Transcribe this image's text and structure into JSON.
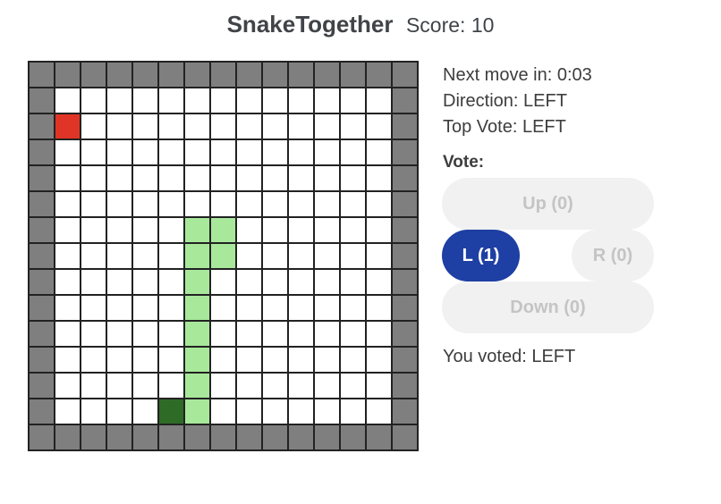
{
  "header": {
    "title": "SnakeTogether",
    "score": "Score: 10"
  },
  "info": {
    "next_move": "Next move in: 0:03",
    "direction": "Direction: LEFT",
    "top_vote": "Top Vote: LEFT"
  },
  "vote": {
    "label": "Vote:",
    "up": "Up (0)",
    "left": "L (1)",
    "right": "R (0)",
    "down": "Down (0)",
    "selected": "left",
    "you_voted": "You voted: LEFT"
  },
  "board": {
    "cols": 15,
    "rows": 15,
    "food": [
      [
        1,
        2
      ]
    ],
    "snake_head": [
      [
        5,
        13
      ]
    ],
    "snake_body": [
      [
        6,
        6
      ],
      [
        7,
        6
      ],
      [
        6,
        7
      ],
      [
        7,
        7
      ],
      [
        6,
        8
      ],
      [
        6,
        9
      ],
      [
        6,
        10
      ],
      [
        6,
        11
      ],
      [
        6,
        12
      ],
      [
        6,
        13
      ]
    ]
  },
  "colors": {
    "wall": "#7f7f7f",
    "empty": "#ffffff",
    "food": "#e03526",
    "snake_head": "#2e6b27",
    "snake_body": "#a8e89b",
    "vote_active": "#1e3fa3",
    "vote_inactive": "#f1f1f1"
  }
}
